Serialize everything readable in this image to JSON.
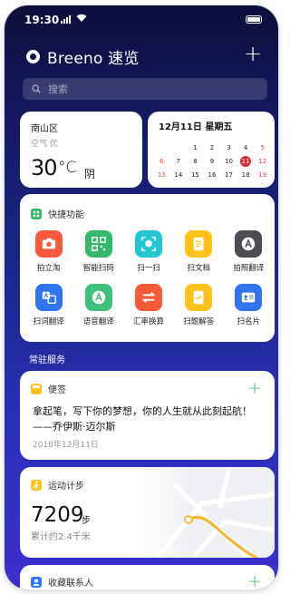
{
  "status_bar": {
    "time": "19:30"
  },
  "header": {
    "title": "Breeno 速览"
  },
  "search": {
    "placeholder": "搜索"
  },
  "weather": {
    "district": "南山区",
    "air_quality": "空气 优",
    "temperature": "30",
    "unit": "°C",
    "condition": "阴"
  },
  "calendar": {
    "header": "12月11日  星期五",
    "rows": [
      [
        null,
        null,
        "1",
        "2",
        "3",
        "4",
        "5"
      ],
      [
        "6",
        "7",
        "8",
        "9",
        "10",
        "11",
        "12"
      ],
      [
        "13",
        "14",
        "15",
        "16",
        "17",
        "18",
        "19"
      ]
    ],
    "today": "11",
    "weekend_color": "#e34848",
    "today_color": "#d9293c"
  },
  "quick_functions": {
    "title": "快捷功能",
    "items": [
      {
        "label": "拍立淘",
        "icon": "camera-icon",
        "color": "#fa5a3c"
      },
      {
        "label": "智能扫码",
        "icon": "qr-code-icon",
        "color": "#34b96a"
      },
      {
        "label": "扫一扫",
        "icon": "scan-cube-icon",
        "color": "#23c6d3"
      },
      {
        "label": "扫文档",
        "icon": "document-icon",
        "color": "#ffc21a"
      },
      {
        "label": "拍照翻译",
        "icon": "translate-a-icon",
        "color": "#4c4c52"
      },
      {
        "label": "扫词翻译",
        "icon": "word-translate-icon",
        "color": "#2f74f0"
      },
      {
        "label": "语音翻译",
        "icon": "voice-translate-icon",
        "color": "#3ec27b"
      },
      {
        "label": "汇率换算",
        "icon": "exchange-icon",
        "color": "#f75a34"
      },
      {
        "label": "扫题解答",
        "icon": "question-check-icon",
        "color": "#ffc21a"
      },
      {
        "label": "扫名片",
        "icon": "business-card-icon",
        "color": "#2f74f0"
      }
    ]
  },
  "section": {
    "title": "常驻服务"
  },
  "note": {
    "title": "便签",
    "content": "拿起笔，写下你的梦想，你的人生就从此刻起航！——乔伊斯·迈尔斯",
    "date": "2018年12月11日"
  },
  "steps": {
    "title": "运动计步",
    "count": "7209",
    "unit": "步",
    "total": "累计约2.4千米"
  },
  "contacts": {
    "title": "收藏联系人"
  }
}
